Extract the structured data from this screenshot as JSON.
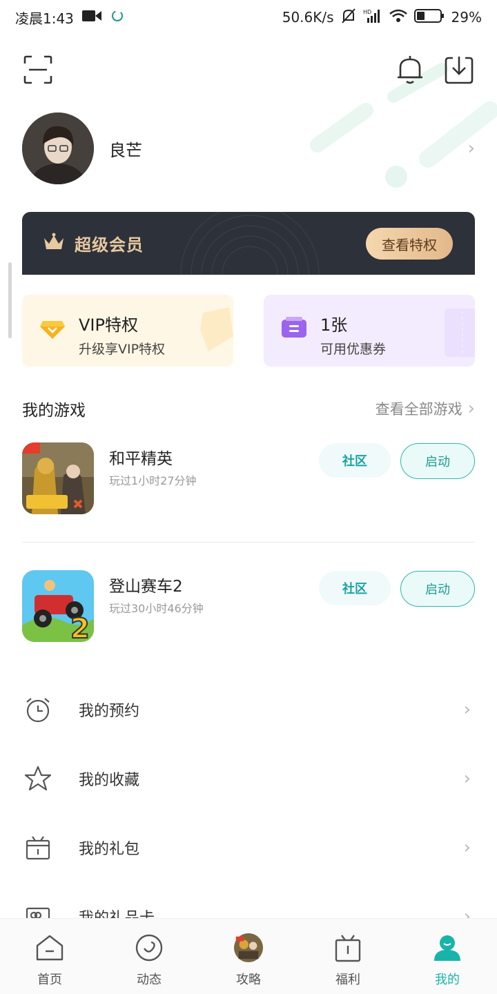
{
  "status_bar": {
    "time": "凌晨1:43",
    "speed": "50.6K/s",
    "battery": "29%"
  },
  "profile": {
    "username": "良芒"
  },
  "vip_banner": {
    "title": "超级会员",
    "button_label": "查看特权"
  },
  "cards": {
    "vip": {
      "title": "VIP特权",
      "subtitle": "升级享VIP特权"
    },
    "coupon": {
      "title": "1张",
      "subtitle": "可用优惠券"
    }
  },
  "my_games": {
    "title": "我的游戏",
    "view_all": "查看全部游戏",
    "games": [
      {
        "name": "和平精英",
        "playtime": "玩过1小时27分钟",
        "community_label": "社区",
        "launch_label": "启动"
      },
      {
        "name": "登山赛车2",
        "playtime": "玩过30小时46分钟",
        "community_label": "社区",
        "launch_label": "启动"
      }
    ]
  },
  "menu": [
    {
      "label": "我的预约",
      "icon": "alarm-clock-icon"
    },
    {
      "label": "我的收藏",
      "icon": "star-icon"
    },
    {
      "label": "我的礼包",
      "icon": "gift-box-icon"
    },
    {
      "label": "我的礼品卡",
      "icon": "gift-card-icon"
    }
  ],
  "bottom_nav": [
    {
      "label": "首页",
      "icon": "home-icon"
    },
    {
      "label": "动态",
      "icon": "feed-icon"
    },
    {
      "label": "攻略",
      "icon": "game-avatar-icon"
    },
    {
      "label": "福利",
      "icon": "gift-icon"
    },
    {
      "label": "我的",
      "icon": "profile-icon",
      "active": true
    }
  ],
  "colors": {
    "accent": "#18b4aa",
    "vip_banner_bg": "#2d3139",
    "vip_gold": "#e7c9a1"
  }
}
